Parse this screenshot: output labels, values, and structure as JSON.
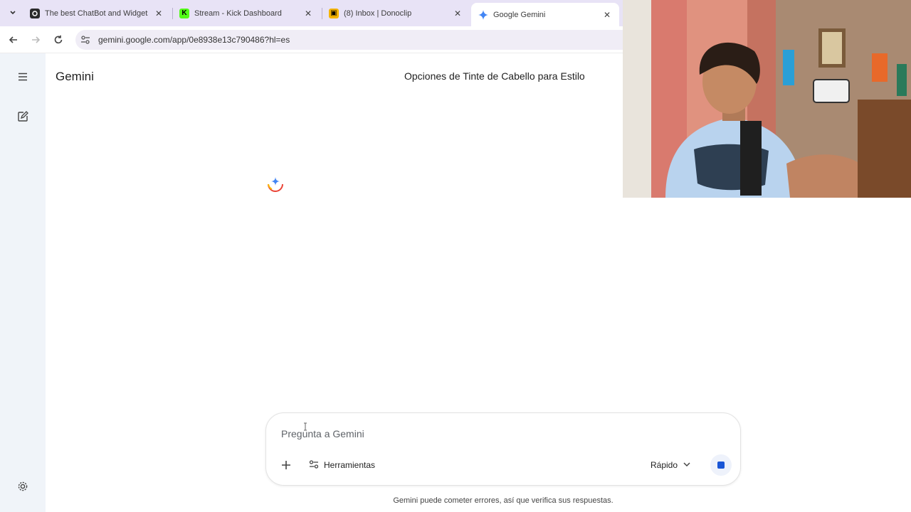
{
  "browser": {
    "tabs": [
      {
        "title": "The best ChatBot and Widgets",
        "favicon_color": "#2b2b2b"
      },
      {
        "title": "Stream - Kick Dashboard",
        "favicon_color": "#53fc18"
      },
      {
        "title": "(8) Inbox | Donoclip",
        "favicon_color": "#f5b400"
      },
      {
        "title": "Google Gemini",
        "favicon_color": "#4285f4",
        "active": true
      }
    ],
    "url": "gemini.google.com/app/0e8938e13c790486?hl=es"
  },
  "app": {
    "brand": "Gemini",
    "chat_title": "Opciones de Tinte de Cabello para Estilo"
  },
  "prompt": {
    "placeholder": "Pregunta a Gemini",
    "tools_label": "Herramientas",
    "model_label": "Rápido"
  },
  "footer": {
    "disclaimer": "Gemini puede cometer errores, así que verifica sus respuestas."
  },
  "colors": {
    "tabstrip": "#e8e3f6",
    "rail": "#f0f4f9",
    "stop_accent": "#1a56d6"
  }
}
